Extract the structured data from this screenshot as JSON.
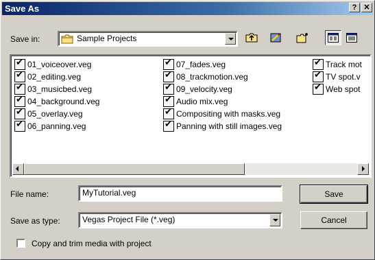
{
  "window": {
    "title": "Save As",
    "help_button": "?",
    "close_button": "✕"
  },
  "save_in": {
    "label": "Save in:",
    "folder": "Sample Projects"
  },
  "toolbar": {
    "up_icon": "up-one-level-icon",
    "desktop_icon": "desktop-icon",
    "new_folder_icon": "new-folder-icon",
    "list_view_icon": "list-view-icon",
    "details_view_icon": "details-view-icon"
  },
  "files": {
    "col1": [
      "01_voiceover.veg",
      "02_editing.veg",
      "03_musicbed.veg",
      "04_background.veg",
      "05_overlay.veg",
      "06_panning.veg"
    ],
    "col2": [
      "07_fades.veg",
      "08_trackmotion.veg",
      "09_velocity.veg",
      "Audio mix.veg",
      "Compositing with masks.veg",
      "Panning with still images.veg"
    ],
    "col3": [
      "Track mot",
      "TV spot.v",
      "Web spot"
    ]
  },
  "file_name": {
    "label": "File name:",
    "value": "MyTutorial.veg"
  },
  "save_type": {
    "label": "Save as type:",
    "value": "Vegas Project File (*.veg)"
  },
  "buttons": {
    "save": "Save",
    "cancel": "Cancel"
  },
  "copy_trim": {
    "label": "Copy and trim media with project",
    "checked": false
  }
}
